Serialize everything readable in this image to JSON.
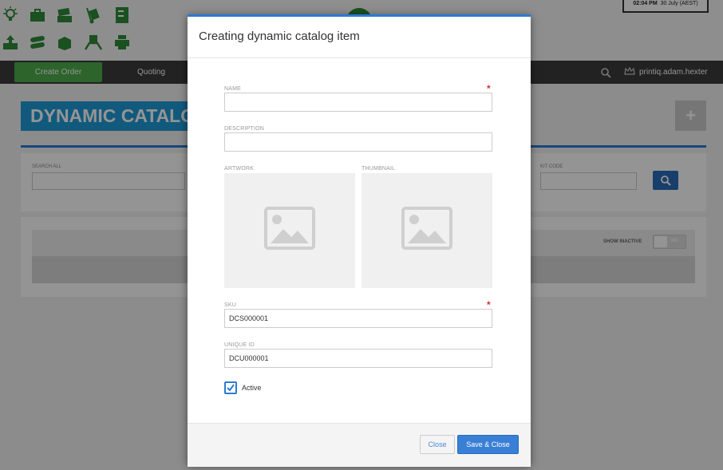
{
  "header": {
    "clock_time": "02:04 PM",
    "clock_date": "30 July (AEST)",
    "toolbar_icons": [
      "lightbulb-icon",
      "briefcase-icon",
      "box-stack-icon",
      "hand-truck-icon",
      "cabinet-icon",
      "box-arrow-icon",
      "rolls-icon",
      "package-icon",
      "hands-box-icon",
      "printer-icon"
    ]
  },
  "nav": {
    "create_order": "Create Order",
    "quoting": "Quoting",
    "user": "printiq.adam.hexter"
  },
  "page": {
    "title": "DYNAMIC CATALOG",
    "add_button": "+",
    "search_all_label": "SEARCH ALL",
    "kit_code_label": "KIT CODE",
    "show_inactive_label": "SHOW INACTIVE",
    "toggle_label": "NO"
  },
  "modal": {
    "title": "Creating dynamic catalog item",
    "name_label": "NAME",
    "name_value": "",
    "description_label": "DESCRIPTION",
    "description_value": "",
    "artwork_label": "ARTWORK",
    "thumbnail_label": "THUMBNAIL",
    "sku_label": "SKU",
    "sku_value": "DCS000001",
    "unique_id_label": "UNIQUE ID",
    "unique_id_value": "DCU000001",
    "required_mark": "*",
    "active_label": "Active",
    "active_checked": true,
    "close_button": "Close",
    "save_close_button": "Save & Close"
  },
  "colors": {
    "accent": "#2a7bd4",
    "create_green": "#4cad4c",
    "title_blue": "#1f9bd7",
    "required_red": "#d9302c"
  }
}
